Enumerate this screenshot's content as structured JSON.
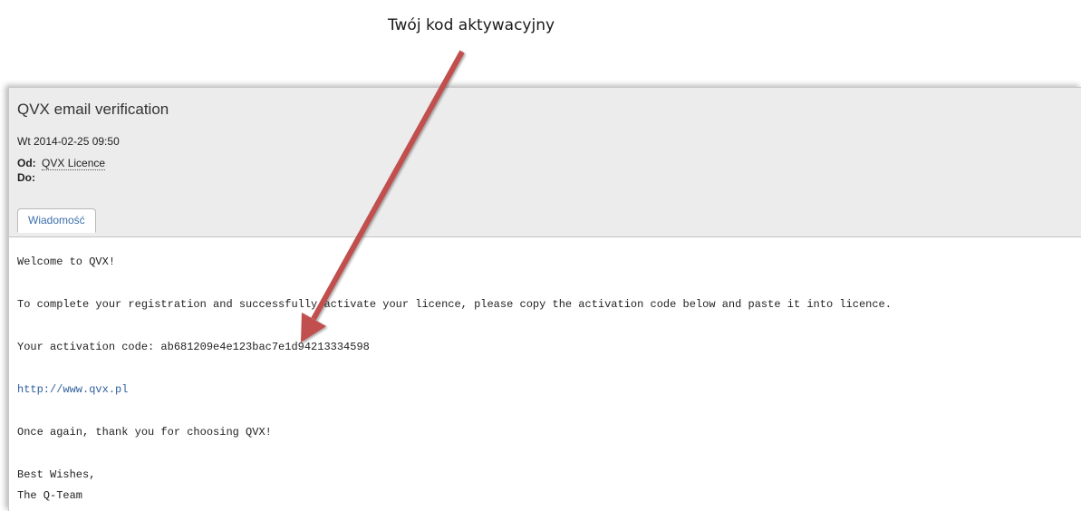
{
  "annotation": {
    "caption": "Twój kod aktywacyjny",
    "arrow_color": "#c0504d"
  },
  "email": {
    "subject": "QVX email verification",
    "date": "Wt 2014-02-25 09:50",
    "from_label": "Od:",
    "from_value": "QVX Licence",
    "to_label": "Do:",
    "to_value": "",
    "tab_label": "Wiadomość"
  },
  "body": {
    "greeting": "Welcome to QVX!",
    "instructions": "To complete your registration and successfully activate your licence, please copy the activation code below and paste it into licence.",
    "activation_code_line": "Your activation code: ab681209e4e123bac7e1d94213334598",
    "link": "http://www.qvx.pl",
    "thanks": "Once again, thank you for choosing QVX!",
    "closing": "Best Wishes,",
    "signature": "The Q-Team"
  },
  "colors": {
    "header_bg": "#ececec",
    "link": "#2f5f9c",
    "tab_text": "#3c6fad"
  }
}
